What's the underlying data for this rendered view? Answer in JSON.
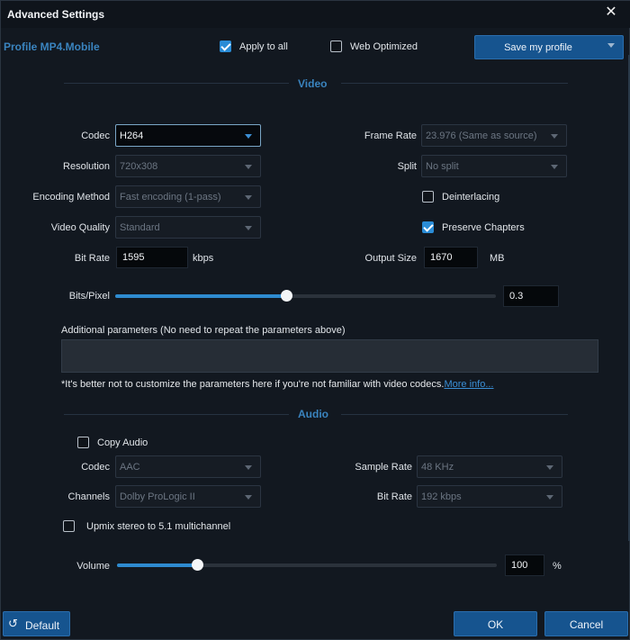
{
  "window": {
    "title": "Advanced Settings",
    "close_glyph": "✕"
  },
  "profile": {
    "name": "Profile MP4.Mobile"
  },
  "options": {
    "apply_to_all": {
      "label": "Apply to all",
      "checked": true
    },
    "web_optimized": {
      "label": "Web Optimized",
      "checked": false
    }
  },
  "save_profile": {
    "label": "Save my profile"
  },
  "video": {
    "section_title": "Video",
    "codec": {
      "label": "Codec",
      "value": "H264"
    },
    "resolution": {
      "label": "Resolution",
      "value": "720x308"
    },
    "encoding_method": {
      "label": "Encoding Method",
      "value": "Fast encoding (1-pass)"
    },
    "video_quality": {
      "label": "Video Quality",
      "value": "Standard"
    },
    "bit_rate": {
      "label": "Bit Rate",
      "value": "1595",
      "unit": "kbps"
    },
    "frame_rate": {
      "label": "Frame Rate",
      "value": "23.976 (Same as source)"
    },
    "split": {
      "label": "Split",
      "value": "No split"
    },
    "deinterlacing": {
      "label": "Deinterlacing",
      "checked": false
    },
    "preserve_chapters": {
      "label": "Preserve Chapters",
      "checked": true
    },
    "output_size": {
      "label": "Output Size",
      "value": "1670",
      "unit": "MB"
    },
    "bits_pixel": {
      "label": "Bits/Pixel",
      "value": "0.3",
      "slider_fraction": 0.45
    },
    "additional_params": {
      "label": "Additional parameters (No need to repeat the parameters above)",
      "value": ""
    },
    "note": "*It's better not to customize the parameters here if you're not familiar with video codecs.",
    "more_info": "More info..."
  },
  "audio": {
    "section_title": "Audio",
    "copy_audio": {
      "label": "Copy Audio",
      "checked": false
    },
    "codec": {
      "label": "Codec",
      "value": "AAC"
    },
    "channels": {
      "label": "Channels",
      "value": "Dolby ProLogic II"
    },
    "sample_rate": {
      "label": "Sample Rate",
      "value": "48 KHz"
    },
    "bit_rate": {
      "label": "Bit Rate",
      "value": "192 kbps"
    },
    "upmix": {
      "label": "Upmix stereo to 5.1 multichannel",
      "checked": false
    },
    "volume": {
      "label": "Volume",
      "value": "100",
      "unit": "%",
      "slider_fraction": 0.21
    }
  },
  "footer": {
    "default_label": "Default",
    "ok_label": "OK",
    "cancel_label": "Cancel"
  },
  "colors": {
    "accent": "#3a84bf",
    "button": "#16548f",
    "checkbox_on": "#2a8cd6",
    "background": "#121820"
  }
}
